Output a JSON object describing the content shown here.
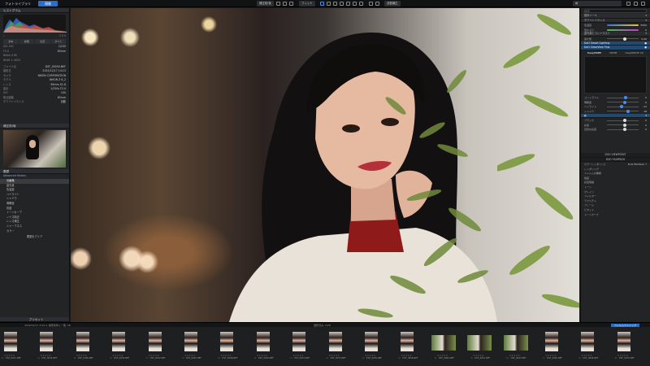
{
  "topbar": {
    "tabs": [
      "フォトライブラリ",
      "現像"
    ],
    "active_tab": "現像",
    "zoom": "フィット",
    "right_buttons": [
      "補正前/後",
      "自動補正"
    ],
    "search_hint": "検索"
  },
  "left_panel": {
    "histogram_title": "ヒストグラム",
    "histogram_values": {
      "r": "0",
      "g": "0",
      "b": "0",
      "l": "0"
    },
    "shooting_info_rows": [
      {
        "k": "ISO 100",
        "v": "1/250"
      },
      {
        "k": "F2.0",
        "v": "85mm"
      },
      {
        "k": "Nikon Z 6II",
        "v": ""
      },
      {
        "k": "6048 × 4024",
        "v": ""
      }
    ],
    "tabs": [
      "基本",
      "詳細",
      "位置",
      "すべて"
    ],
    "exif_rows": [
      {
        "k": "ファイル名",
        "v": "DSF_00000.NEF"
      },
      {
        "k": "撮影日",
        "v": "2022/12/17 14:13"
      },
      {
        "k": "カメラ",
        "v": "NIKON CORPORATION"
      },
      {
        "k": "モデル",
        "v": "NIKON Z 6_2"
      },
      {
        "k": "レンズ",
        "v": "85mm f/1.8"
      },
      {
        "k": "露出",
        "v": "1/250s F2.0"
      },
      {
        "k": "ISO",
        "v": "100"
      },
      {
        "k": "焦点距離",
        "v": "85mm"
      },
      {
        "k": "ホワイトバランス",
        "v": "自動"
      }
    ],
    "preview_title": "補正前/後",
    "history_title": "履歴",
    "history_group": "Advanced History",
    "history_items": [
      "元画像",
      "露光量",
      "色温度",
      "ハイライト",
      "シャドウ",
      "明瞭度",
      "彩度",
      "トーンカーブ",
      "ノイズ除去",
      "レンズ補正",
      "シャープネス",
      "カラー"
    ],
    "history_selected": 0,
    "reset_label": "履歴をクリア",
    "bottom_label": "プリセット"
  },
  "right_panel": {
    "search_placeholder": "検索",
    "section_basic": "基本ツール",
    "sub_sections": [
      "ホワイトバランス",
      "露光量とコントラスト",
      "DxO Smart Lighting",
      "DxO ClearView Plus"
    ],
    "sliders": [
      {
        "label": "色温度",
        "value": "5500"
      },
      {
        "label": "色かぶり",
        "value": "0"
      },
      {
        "label": "露光量",
        "value": "0.00"
      },
      {
        "label": "コントラスト",
        "value": "0"
      },
      {
        "label": "明瞭度",
        "value": "0"
      },
      {
        "label": "ハイライト",
        "value": "-12"
      },
      {
        "label": "シャドウ",
        "value": "18"
      },
      {
        "label": "ブラック",
        "value": "0"
      },
      {
        "label": "彩度",
        "value": "0"
      },
      {
        "label": "自然な彩度",
        "value": "0"
      }
    ],
    "mode_options": [
      "DeepPRIME",
      "PRIME",
      "DeepPRIME XD"
    ],
    "mode_selected": "DeepPRIME",
    "section_viewpoint": "DXO VIEWPOINT",
    "section_filmpack": "DXO FILMPACK",
    "filmpack_rows": [
      "カラーレンダリング",
      "レンダリング",
      "フィルムの種類",
      "強度",
      "彩度保護"
    ],
    "filmpack_value": "DxO FilmPack 7",
    "bottom_rows": [
      "トーン",
      "グレイン",
      "フィルター",
      "テクスチャ",
      "フレーム",
      "ビネット",
      "トーンカーブ"
    ]
  },
  "filmstrip": {
    "left_label": "2022/12/17 3:44 A, 検索条件に一致: 28",
    "count_label": "選択済み: 1/28",
    "right_label": "フィルムストリップ",
    "thumbs": [
      {
        "name": "DSF_0021.NEF",
        "kind": "port"
      },
      {
        "name": "DSF_0034.NEF",
        "kind": "port"
      },
      {
        "name": "DSF_0036.NEF",
        "kind": "port"
      },
      {
        "name": "DSF_0039.NEF",
        "kind": "port"
      },
      {
        "name": "DSF_0042.NEF",
        "kind": "port"
      },
      {
        "name": "DSF_0045.NEF",
        "kind": "port"
      },
      {
        "name": "DSF_0048.NEF",
        "kind": "port"
      },
      {
        "name": "DSF_0050.NEF",
        "kind": "port"
      },
      {
        "name": "DSF_0051.NEF",
        "kind": "port"
      },
      {
        "name": "DSF_0053.NEF",
        "kind": "port"
      },
      {
        "name": "DSF_0055.NEF",
        "kind": "port"
      },
      {
        "name": "DSF_0058.NEF",
        "kind": "port"
      },
      {
        "name": "DSF_0060.NEF",
        "kind": "land"
      },
      {
        "name": "DSF_0061.NEF",
        "kind": "land"
      },
      {
        "name": "DSF_0063.NEF",
        "kind": "land"
      },
      {
        "name": "DSF_0065.NEF",
        "kind": "port"
      },
      {
        "name": "DSF_0068.NEF",
        "kind": "port"
      },
      {
        "name": "DSF_0070.NEF",
        "kind": "port"
      }
    ]
  }
}
